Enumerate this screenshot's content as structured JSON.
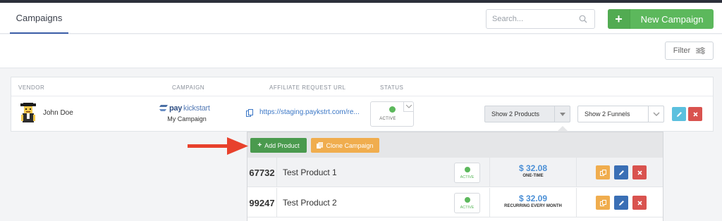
{
  "header": {
    "tab_campaigns": "Campaigns",
    "search_placeholder": "Search...",
    "new_campaign_label": "New Campaign",
    "new_campaign_plus": "+"
  },
  "subbar": {
    "filter_label": "Filter"
  },
  "table": {
    "headers": {
      "vendor": "VENDOR",
      "campaign": "CAMPAIGN",
      "affiliate_url": "AFFILIATE REQUEST URL",
      "status": "STATUS"
    },
    "row": {
      "vendor_name": "John Doe",
      "logo_pay": "pay",
      "logo_kickstart": "kickstart",
      "campaign_name": "My Campaign",
      "affiliate_url": "https://staging.paykstrt.com/re...",
      "status": "ACTIVE",
      "products_select": "Show 2 Products",
      "funnels_select": "Show 2 Funnels"
    }
  },
  "dropdown": {
    "add_product_label": "Add Product",
    "clone_campaign_label": "Clone Campaign",
    "products": [
      {
        "id": "67732",
        "name": "Test Product 1",
        "status": "ACTIVE",
        "price": "$ 32.08",
        "price_type": "ONE-TIME"
      },
      {
        "id": "99247",
        "name": "Test Product 2",
        "status": "ACTIVE",
        "price": "$ 32.09",
        "price_type": "RECURRING EVERY MONTH"
      }
    ]
  },
  "colors": {
    "green": "#5cb85c",
    "orange": "#f0ad4e",
    "red": "#d9534f",
    "blue": "#3a6fb5",
    "light_blue": "#5bc0de",
    "arrow_red": "#e8412c",
    "link_blue": "#3b77c6"
  }
}
